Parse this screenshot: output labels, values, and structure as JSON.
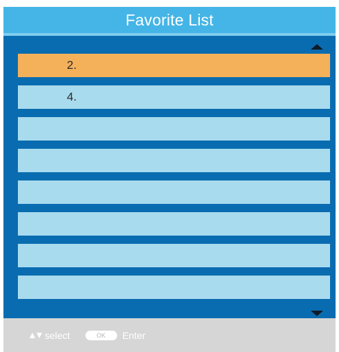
{
  "dialog": {
    "title": "Favorite List"
  },
  "list": {
    "items": [
      {
        "label": "2.",
        "selected": true
      },
      {
        "label": "4.",
        "selected": false
      },
      {
        "label": "",
        "selected": false
      },
      {
        "label": "",
        "selected": false
      },
      {
        "label": "",
        "selected": false
      },
      {
        "label": "",
        "selected": false
      },
      {
        "label": "",
        "selected": false
      },
      {
        "label": "",
        "selected": false
      }
    ]
  },
  "footer": {
    "select_label": "select",
    "ok_key": "OK",
    "enter_label": "Enter"
  },
  "colors": {
    "title_bar": "#44b5e6",
    "panel": "#0a6cb0",
    "row": "#a9dbee",
    "row_selected": "#f5b05a",
    "footer": "#d6d6d6"
  },
  "icons": {
    "scroll_up": "triangle-up-icon",
    "scroll_down": "triangle-down-icon",
    "nav": "up-down-arrows-icon"
  }
}
